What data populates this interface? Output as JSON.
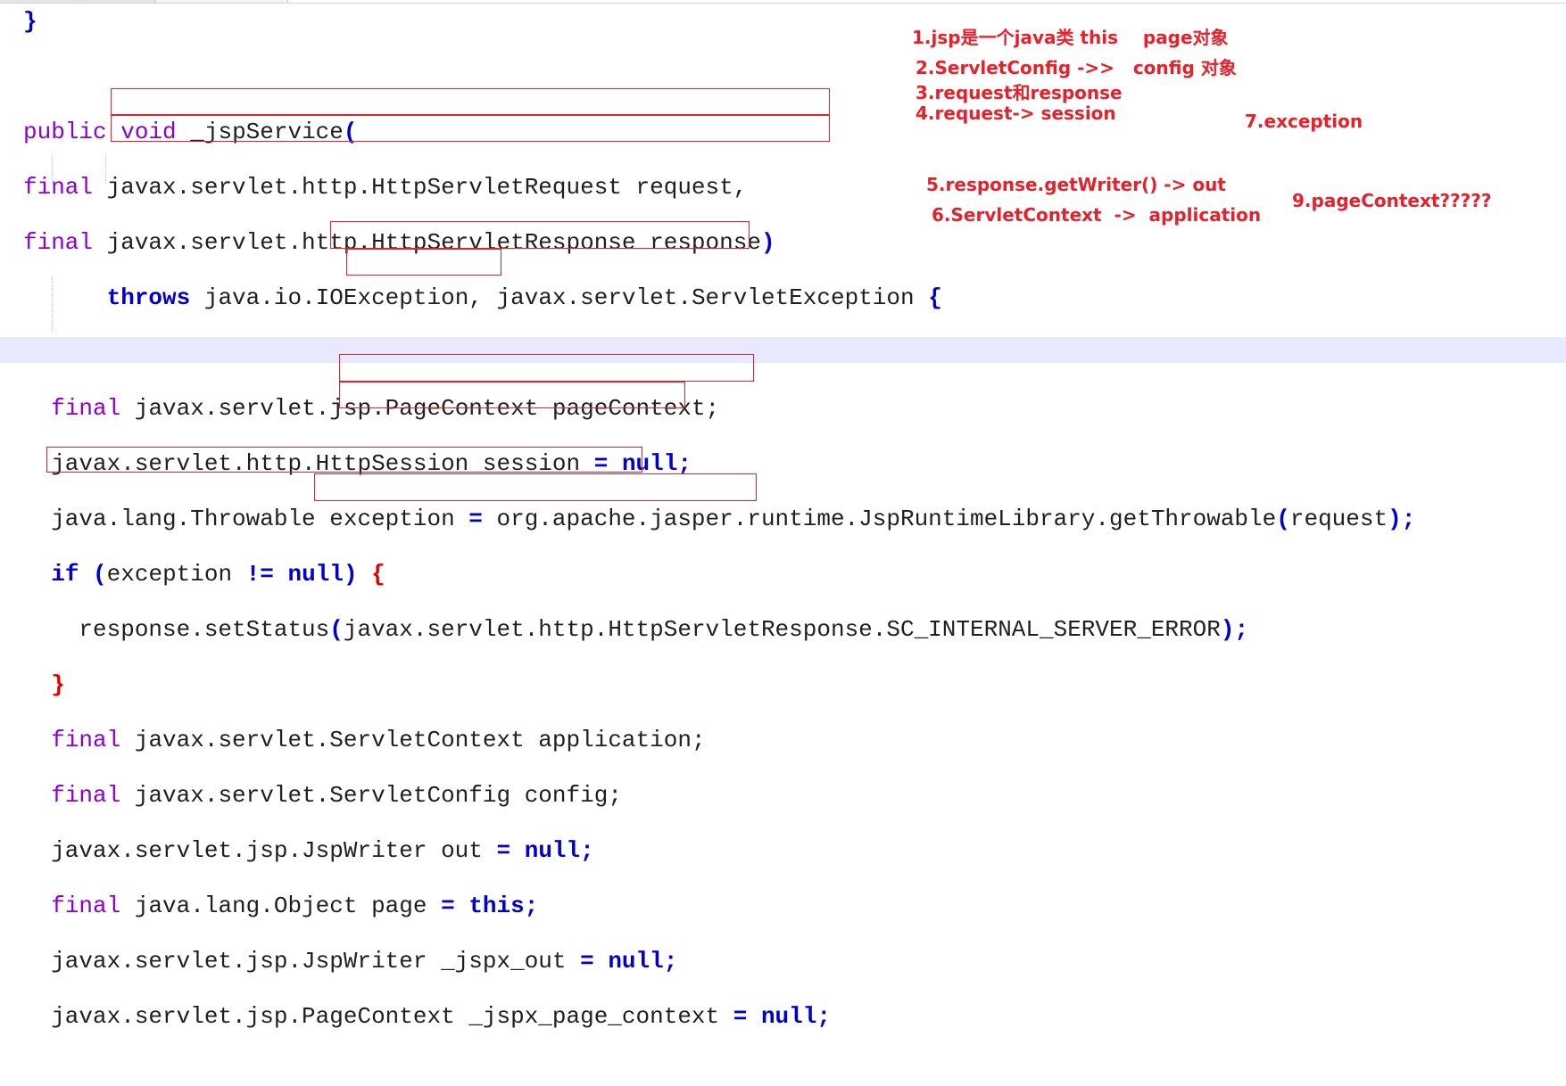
{
  "code_lines": [
    [
      "",
      "}"
    ],
    [
      ""
    ],
    [
      "",
      "public",
      " ",
      "void",
      " _jspService",
      "("
    ],
    [
      "",
      "final",
      " javax.servlet.http.HttpServletRequest request,"
    ],
    [
      "",
      "final",
      " javax.servlet.http.HttpServletResponse response",
      ")"
    ],
    [
      "      ",
      "throws",
      " java.io.IOException, javax.servlet.ServletException ",
      "{"
    ],
    [
      ""
    ],
    [
      "  ",
      "final",
      " javax.servlet.jsp.PageContext pageContext;"
    ],
    [
      "  javax.servlet.http.HttpSession session ",
      "=",
      " ",
      "null",
      ";"
    ],
    [
      "  java.lang.Throwable exception ",
      "=",
      " org.apache.jasper.runtime.JspRuntimeLibrary.getThrowable",
      "(",
      "request",
      ")",
      ";"
    ],
    [
      "  ",
      "if",
      " ",
      "(",
      "exception ",
      "!=",
      " ",
      "null",
      ")",
      " ",
      "{"
    ],
    [
      "    response.setStatus",
      "(",
      "javax.servlet.http.HttpServletResponse.SC_INTERNAL_SERVER_ERROR",
      ")",
      ";"
    ],
    [
      "  ",
      "}"
    ],
    [
      "  ",
      "final",
      " javax.servlet.ServletContext application;"
    ],
    [
      "  ",
      "final",
      " javax.servlet.ServletConfig config;"
    ],
    [
      "  javax.servlet.jsp.JspWriter out ",
      "=",
      " ",
      "null",
      ";"
    ],
    [
      "  ",
      "final",
      " java.lang.Object page ",
      "=",
      " ",
      "this",
      ";"
    ],
    [
      "  javax.servlet.jsp.JspWriter _jspx_out ",
      "=",
      " ",
      "null",
      ";"
    ],
    [
      "  javax.servlet.jsp.PageContext _jspx_page_context ",
      "=",
      " ",
      "null",
      ";"
    ]
  ],
  "annotations": {
    "note_1": "1.jsp是一个java类 this    page对象",
    "note_2": "2.ServletConfig ->>   config 对象",
    "note_3": "3.request和response",
    "note_4": "4.request-> session",
    "note_5": "5.response.getWriter() -> out",
    "note_6": "6.ServletContext  ->  application",
    "note_7": "7.exception",
    "note_9": "9.pageContext?????"
  },
  "colors": {
    "keyword": "#8b00d6",
    "keyword_bold": "#0000d0",
    "brace_red": "#e00000",
    "annotation_red": "#e8202a",
    "current_line": "#e8e8ff"
  }
}
